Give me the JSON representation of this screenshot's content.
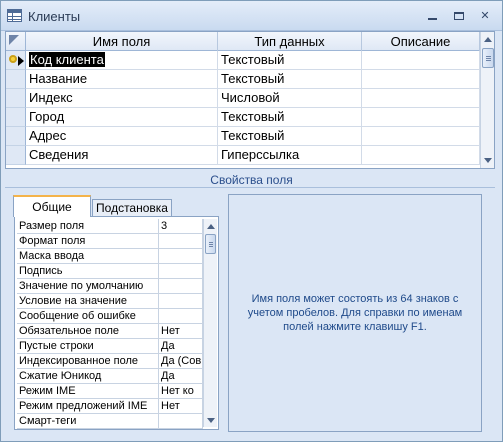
{
  "window": {
    "title": "Клиенты"
  },
  "grid": {
    "columns": [
      "Имя поля",
      "Тип данных",
      "Описание"
    ],
    "rows": [
      {
        "name": "Код клиента",
        "type": "Текстовый",
        "description": ""
      },
      {
        "name": "Название",
        "type": "Текстовый",
        "description": ""
      },
      {
        "name": "Индекс",
        "type": "Числовой",
        "description": ""
      },
      {
        "name": "Город",
        "type": "Текстовый",
        "description": ""
      },
      {
        "name": "Адрес",
        "type": "Текстовый",
        "description": ""
      },
      {
        "name": "Сведения",
        "type": "Гиперссылка",
        "description": ""
      }
    ]
  },
  "props_label": "Свойства поля",
  "tabs": [
    "Общие",
    "Подстановка"
  ],
  "properties": [
    {
      "name": "Размер поля",
      "value": "3"
    },
    {
      "name": "Формат поля",
      "value": ""
    },
    {
      "name": "Маска ввода",
      "value": ""
    },
    {
      "name": "Подпись",
      "value": ""
    },
    {
      "name": "Значение по умолчанию",
      "value": ""
    },
    {
      "name": "Условие на значение",
      "value": ""
    },
    {
      "name": "Сообщение об ошибке",
      "value": ""
    },
    {
      "name": "Обязательное поле",
      "value": "Нет"
    },
    {
      "name": "Пустые строки",
      "value": "Да"
    },
    {
      "name": "Индексированное поле",
      "value": "Да (Сов"
    },
    {
      "name": "Сжатие Юникод",
      "value": "Да"
    },
    {
      "name": "Режим IME",
      "value": "Нет ко"
    },
    {
      "name": "Режим предложений IME",
      "value": "Нет"
    },
    {
      "name": "Смарт-теги",
      "value": ""
    }
  ],
  "help_text": "Имя поля может состоять из 64 знаков с учетом пробелов.  Для справки по именам полей нажмите клавишу F1.",
  "icons": {
    "app": "table-icon",
    "primary_key": "key-icon",
    "current_row": "arrow-right-icon"
  }
}
